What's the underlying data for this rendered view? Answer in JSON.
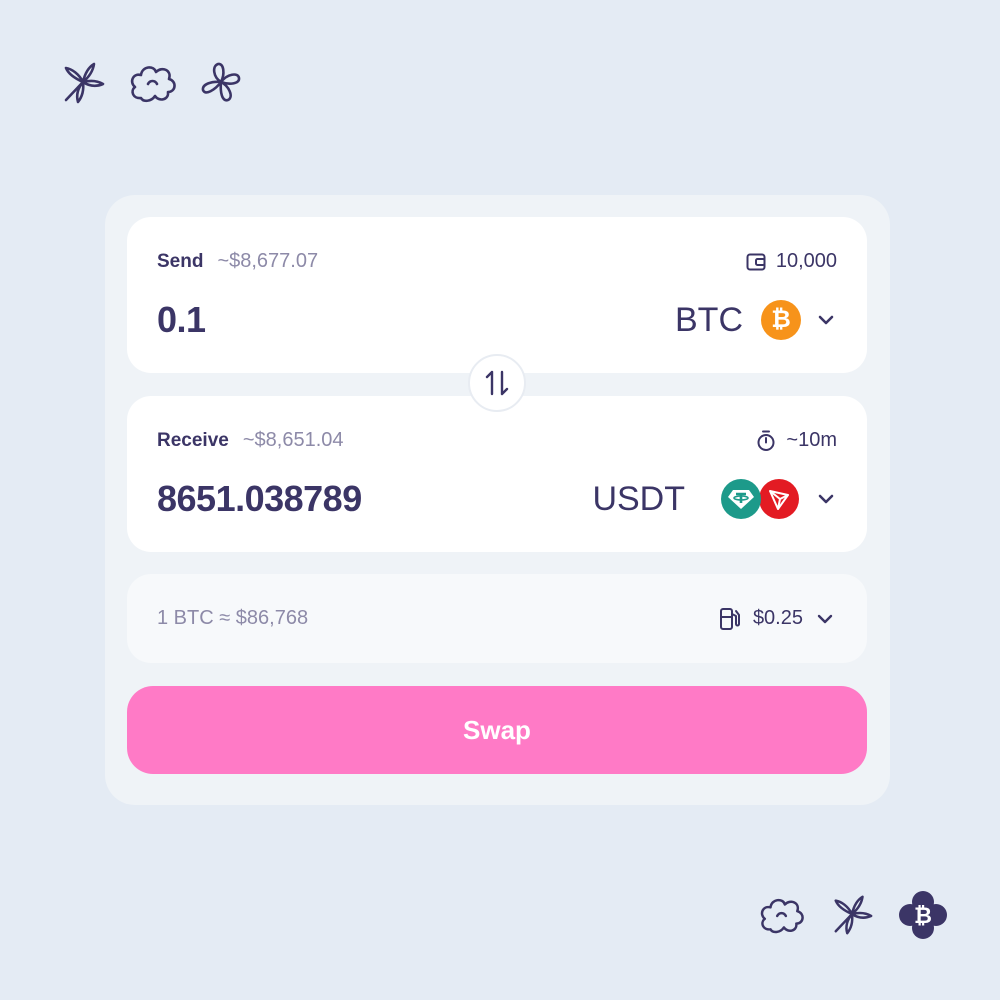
{
  "decorations": {
    "top": [
      "star-flower-icon",
      "cloud-flower-icon",
      "petal-flower-icon"
    ],
    "bottom": [
      "cloud-flower-icon",
      "star-flower-icon",
      "bitcoin-flower-badge-icon"
    ]
  },
  "send": {
    "label": "Send",
    "usd_value": "~$8,677.07",
    "balance_icon": "wallet-icon",
    "balance": "10,000",
    "amount": "0.1",
    "token": "BTC",
    "token_icon": "bitcoin-icon",
    "token_icon_glyph": "₿"
  },
  "switch": {
    "icon": "swap-arrows-icon"
  },
  "receive": {
    "label": "Receive",
    "usd_value": "~$8,651.04",
    "time_icon": "stopwatch-icon",
    "eta": "~10m",
    "amount": "8651.038789",
    "token": "USDT",
    "token_icons": [
      "tether-icon",
      "tron-icon"
    ]
  },
  "rate_bar": {
    "rate": "1 BTC ≈ $86,768",
    "fee_icon": "gas-pump-icon",
    "fee": "$0.25"
  },
  "action": {
    "swap_label": "Swap"
  },
  "colors": {
    "background": "#e4ebf4",
    "panel": "#eff3f7",
    "text": "#3b3566",
    "muted": "#8d8aa8",
    "accent": "#ff7ac6",
    "btc": "#f7931a",
    "tether": "#1d9a8a",
    "tron": "#e31b23"
  }
}
